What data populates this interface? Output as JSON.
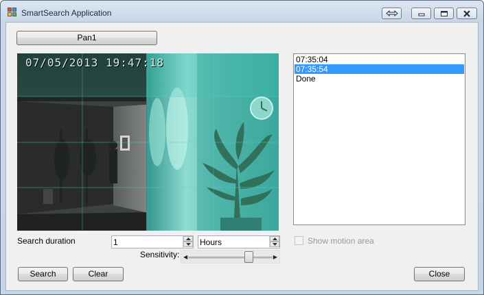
{
  "window": {
    "title": "SmartSearch Application",
    "accent": "#3399ff"
  },
  "caption_buttons": [
    "swap-icon",
    "minimize-icon",
    "maximize-icon",
    "close-icon"
  ],
  "toolbar": {
    "pan_button_label": "Pan1"
  },
  "video": {
    "timestamp": "07/05/2013 19:47:18",
    "overlay_color": "#40c8b8"
  },
  "results_list": {
    "items": [
      "07:35:04",
      "07:35:54",
      "Done"
    ],
    "selected_index": 1
  },
  "search": {
    "duration_label": "Search duration",
    "duration_value": "1",
    "unit_value": "Hours",
    "sensitivity_label": "Sensitivity:",
    "sensitivity_level": 0.75
  },
  "motion": {
    "show_motion_area_label": "Show motion area",
    "checked": false,
    "enabled": false
  },
  "actions": {
    "search_label": "Search",
    "clear_label": "Clear",
    "close_label": "Close"
  }
}
